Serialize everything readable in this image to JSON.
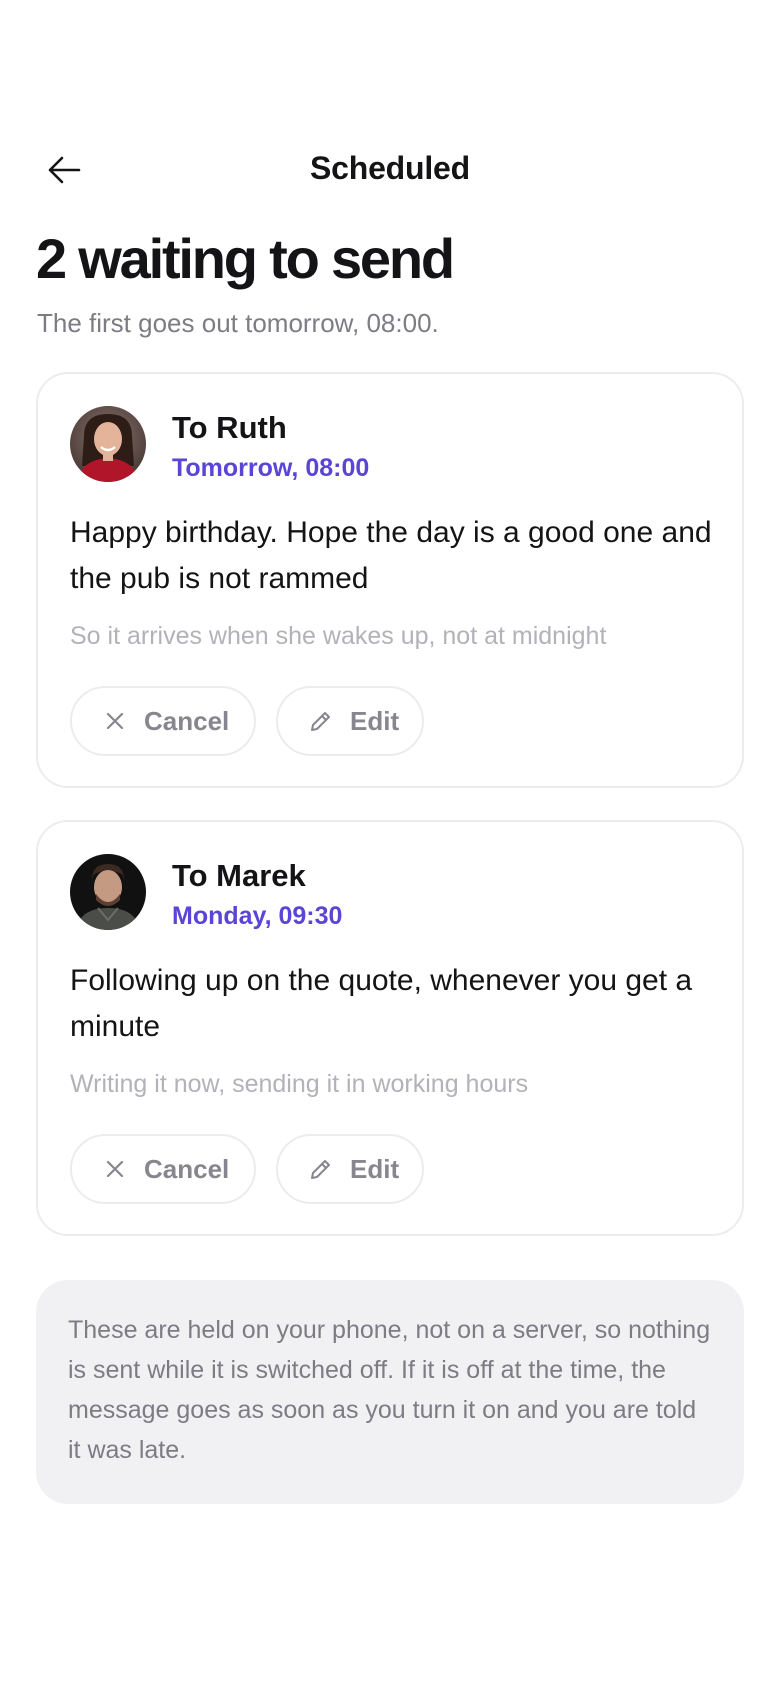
{
  "nav": {
    "title": "Scheduled",
    "back_icon": "arrow-left-icon"
  },
  "header": {
    "title": "2 waiting to send",
    "subtitle": "The first goes out tomorrow, 08:00."
  },
  "scheduled": [
    {
      "recipient": "To Ruth",
      "when": "Tomorrow, 08:00",
      "message": "Happy birthday. Hope the day is a good one and the pub is not rammed",
      "note": "So it arrives when she wakes up, not at midnight",
      "cancel_label": "Cancel",
      "edit_label": "Edit"
    },
    {
      "recipient": "To Marek",
      "when": "Monday, 09:30",
      "message": "Following up on the quote, whenever you get a minute",
      "note": "Writing it now, sending it in working hours",
      "cancel_label": "Cancel",
      "edit_label": "Edit"
    }
  ],
  "info": {
    "text": "These are held on your phone, not on a server, so nothing is sent while it is switched off. If it is off at the time, the message goes as soon as you turn it on and you are told it was late."
  },
  "colors": {
    "accent": "#5b45d6",
    "text": "#141416",
    "muted": "#7c7c84",
    "faint": "#b2b2b8",
    "border": "#ececef",
    "info_bg": "#f1f1f3"
  },
  "icons": {
    "cancel": "close-icon",
    "edit": "pencil-icon"
  }
}
